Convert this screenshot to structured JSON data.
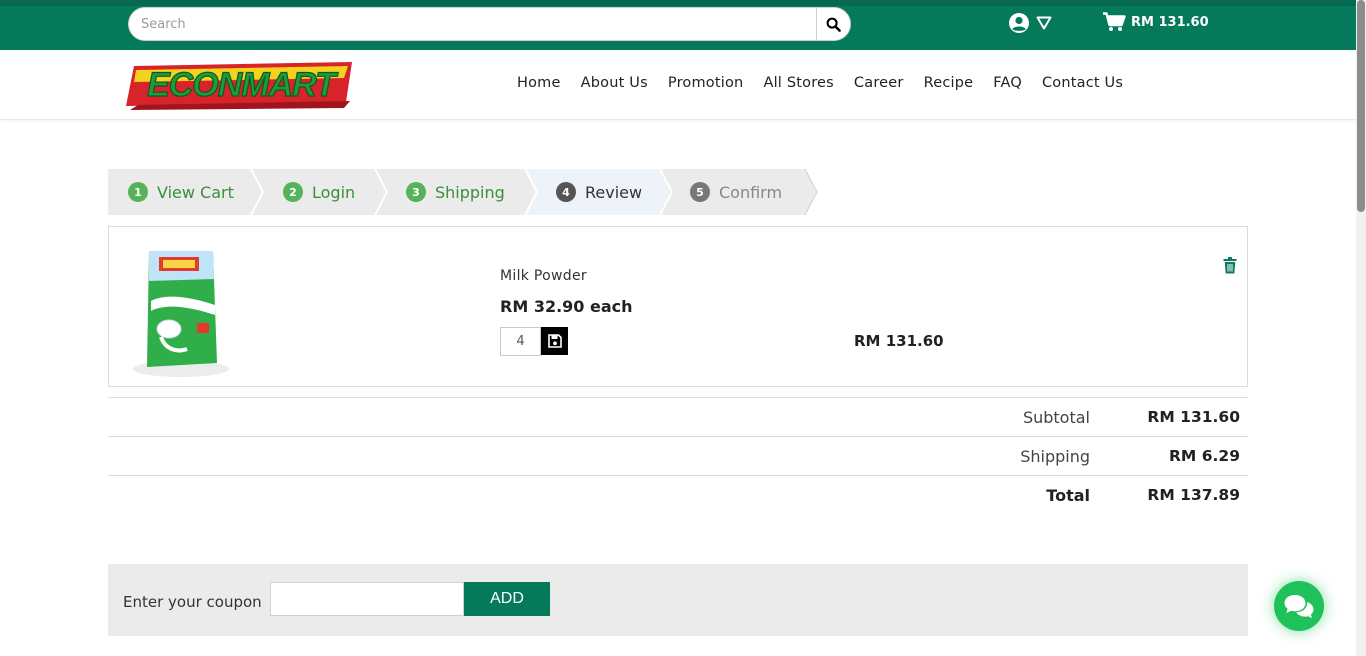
{
  "search": {
    "placeholder": "Search"
  },
  "topbar": {
    "cart_total": "RM 131.60"
  },
  "logo": {
    "text": "ECONMART"
  },
  "nav": [
    "Home",
    "About Us",
    "Promotion",
    "All Stores",
    "Career",
    "Recipe",
    "FAQ",
    "Contact Us"
  ],
  "steps": [
    {
      "num": "1",
      "label": "View Cart"
    },
    {
      "num": "2",
      "label": "Login"
    },
    {
      "num": "3",
      "label": "Shipping"
    },
    {
      "num": "4",
      "label": "Review"
    },
    {
      "num": "5",
      "label": "Confirm"
    }
  ],
  "item": {
    "name": "Milk Powder",
    "price": "RM 32.90 each",
    "qty": "4",
    "line_total": "RM 131.60"
  },
  "totals": {
    "subtotal_label": "Subtotal",
    "subtotal": "RM 131.60",
    "shipping_label": "Shipping",
    "shipping": "RM 6.29",
    "total_label": "Total",
    "total": "RM 137.89"
  },
  "coupon": {
    "label": "Enter your coupon",
    "button": "ADD"
  },
  "colors": {
    "brand_green": "#047a5b",
    "step_done": "#57b35a",
    "chat": "#1fc25a"
  }
}
